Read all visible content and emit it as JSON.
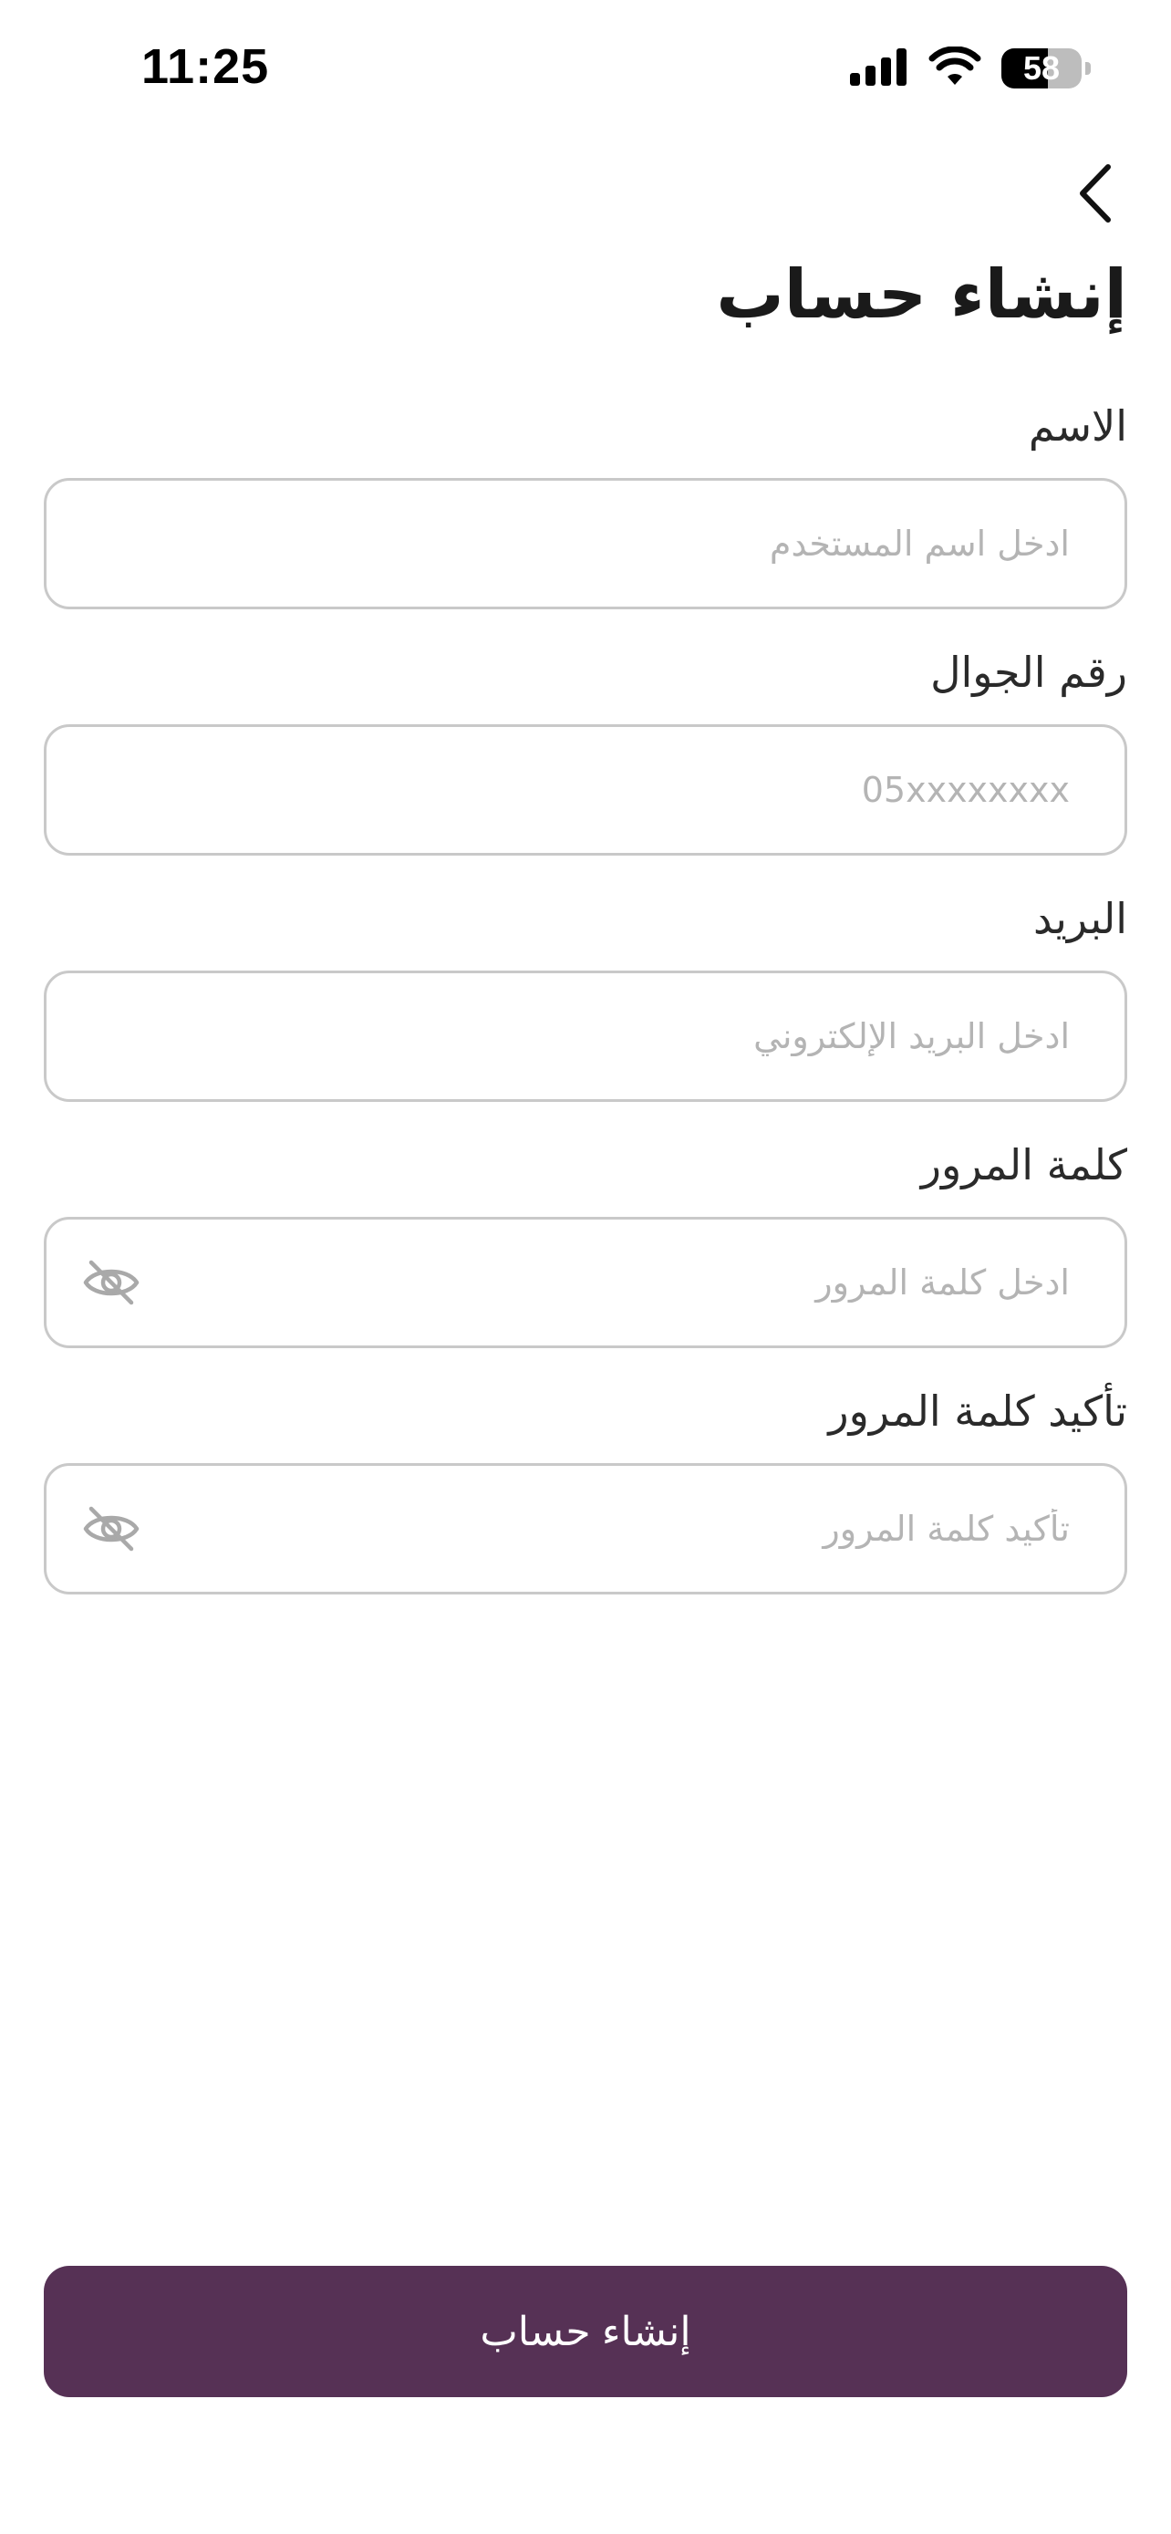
{
  "status_bar": {
    "time": "11:25",
    "battery_level": "58",
    "icons": [
      "signal-icon",
      "wifi-icon",
      "battery-icon"
    ]
  },
  "header": {
    "back_icon": "chevron-left-icon",
    "title": "إنشاء حساب"
  },
  "form": {
    "name": {
      "label": "الاسم",
      "placeholder": "ادخل اسم المستخدم",
      "value": ""
    },
    "phone": {
      "label": "رقم الجوال",
      "placeholder": "05xxxxxxxx",
      "value": ""
    },
    "email": {
      "label": "البريد",
      "placeholder": "ادخل البريد الإلكتروني",
      "value": ""
    },
    "password": {
      "label": "كلمة المرور",
      "placeholder": "ادخل كلمة المرور",
      "value": "",
      "toggle_icon": "eye-off-icon"
    },
    "confirm_password": {
      "label": "تأكيد كلمة المرور",
      "placeholder": "تأكيد كلمة المرور",
      "value": "",
      "toggle_icon": "eye-off-icon"
    }
  },
  "submit": {
    "label": "إنشاء حساب"
  },
  "colors": {
    "primary": "#563155",
    "border": "#c9c9c9",
    "placeholder": "#b4b4b4",
    "text": "#1a1a1a"
  }
}
